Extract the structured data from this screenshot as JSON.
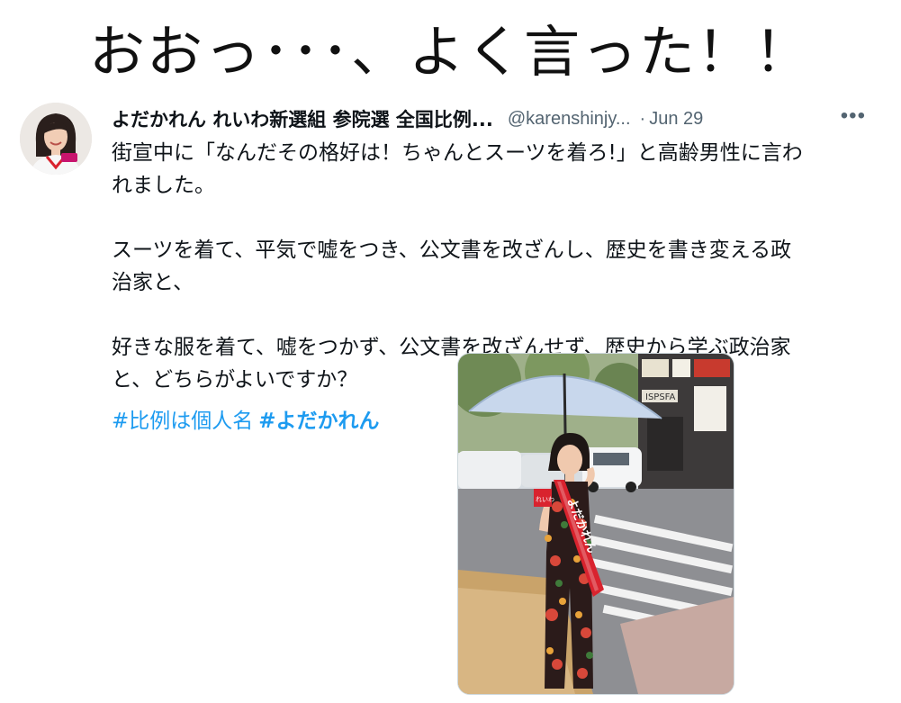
{
  "caption": "おおっ･･･、よく言った！！",
  "tweet": {
    "display_name": "よだかれん れいわ新選組 参院選 全国比例...",
    "handle": "@karenshinjy...",
    "separator": "·",
    "date": "Jun 29",
    "more_label": "•••",
    "paragraphs": [
      [
        "街宣中に「なんだその格好は！ちゃんとスーツを着ろ!」と高齢男性に言わ",
        "れました。"
      ],
      [
        "スーツを着て、平気で嘘をつき、公文書を改ざんし、歴史を書き変える政",
        "治家と、"
      ],
      [
        "好きな服を着て、嘘をつかず、公文書を改ざんせず、歴史から学ぶ政治家",
        "と、どちらがよいですか？"
      ]
    ],
    "hashtags": [
      "#比例は個人名",
      "#よだかれん"
    ]
  },
  "media": {
    "sash_text": "よだかれん",
    "sash_top": "れいわ",
    "shop_sign": "ISPSFA"
  },
  "colors": {
    "link": "#1d9bf0",
    "muted": "#536471",
    "text": "#0f1419",
    "sash": "#d9232e"
  },
  "icons": {
    "more": "more-horizontal-icon",
    "avatar": "profile-avatar"
  }
}
